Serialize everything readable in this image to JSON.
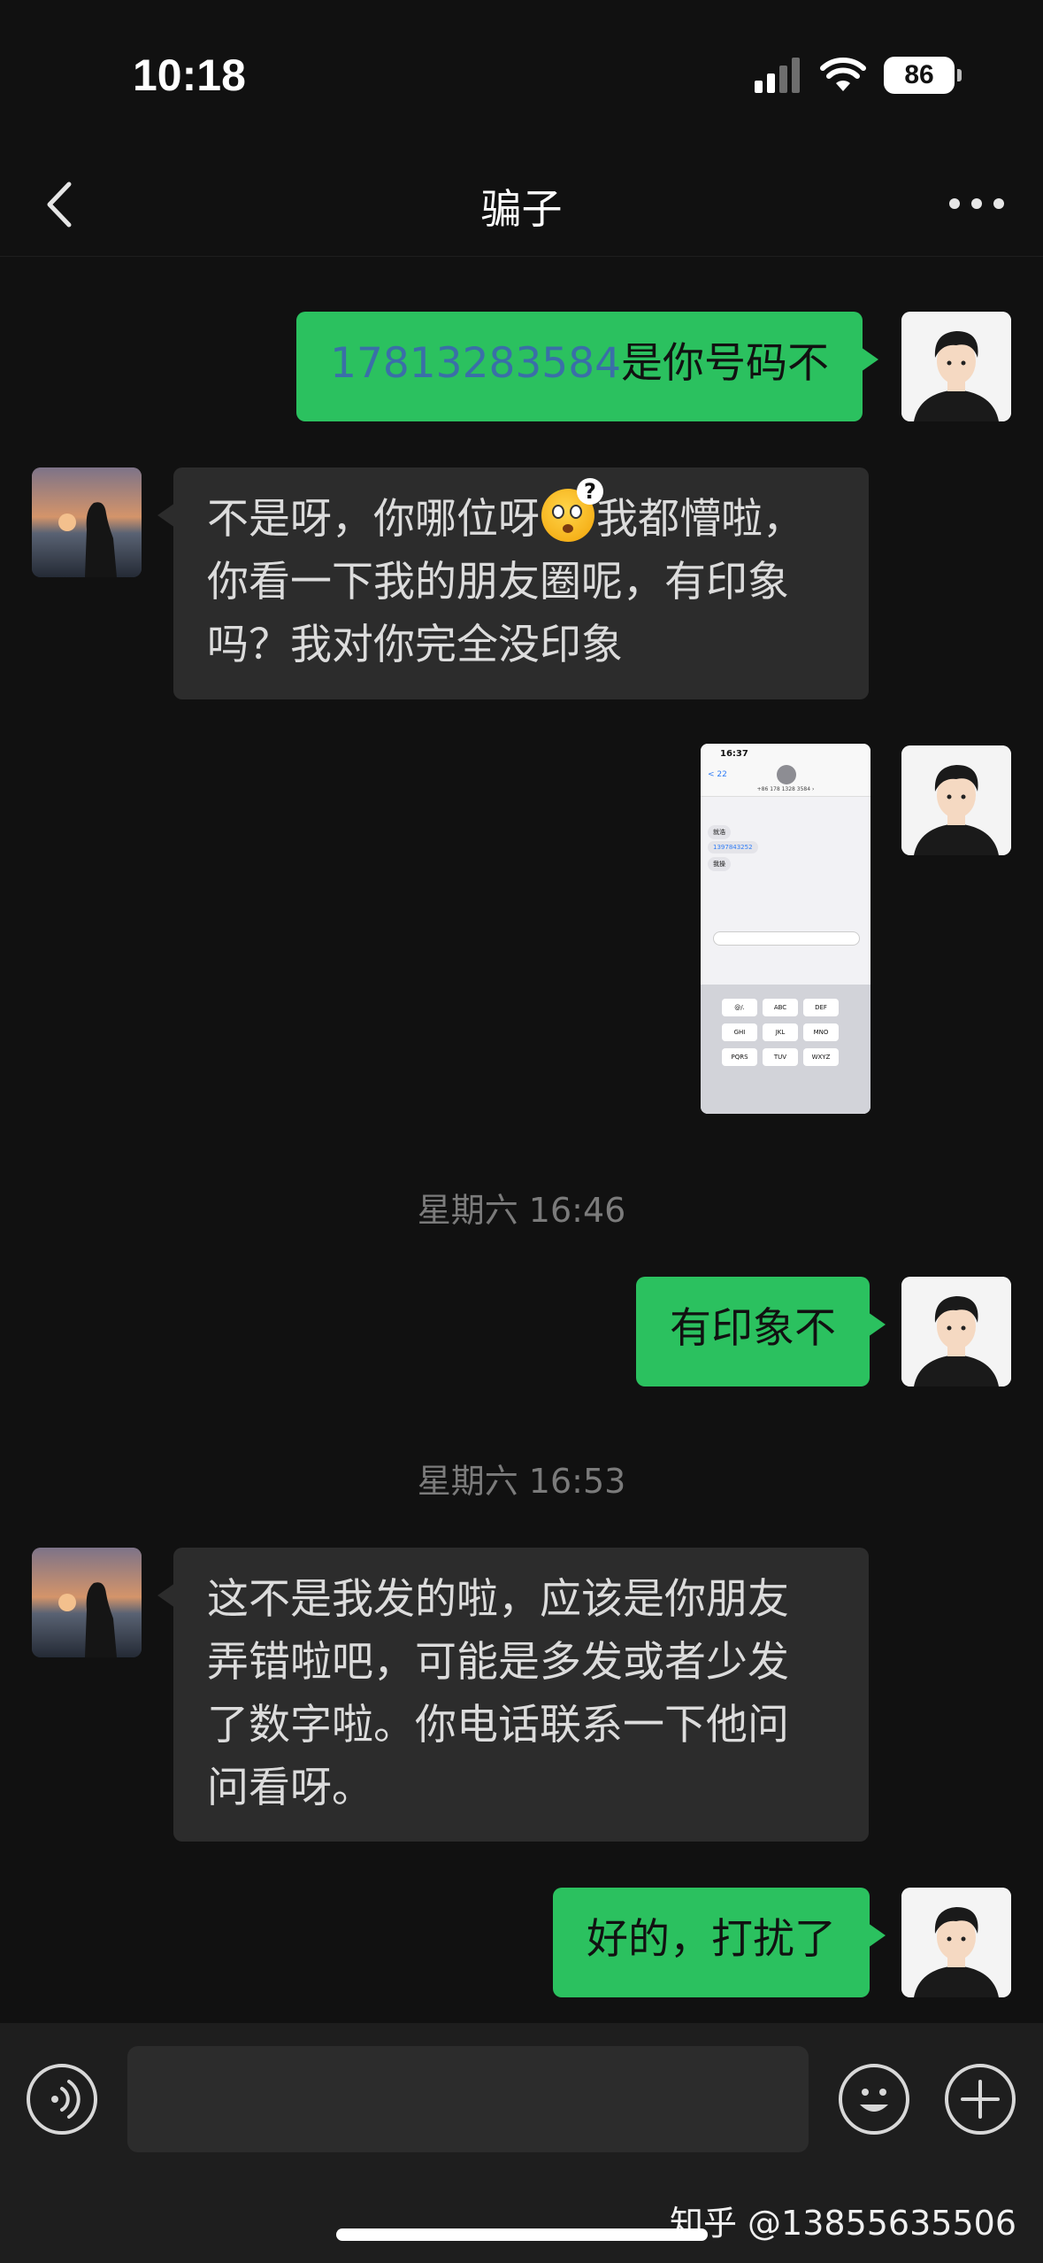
{
  "status_bar": {
    "time": "10:18",
    "battery": "86"
  },
  "header": {
    "title": "骗子",
    "back_icon": "chevron-left-icon",
    "more_icon": "more-dots-icon"
  },
  "messages": [
    {
      "from": "me",
      "phone": "17813283584",
      "text": "是你号码不"
    },
    {
      "from": "her",
      "line1_a": "不是呀，你哪位呀",
      "line1_b": "我都懵啦，",
      "line2": "你看一下我的朋友圈呢，有印象",
      "line3": "吗？我对你完全没印象",
      "emoji": "confused-face-emoji"
    },
    {
      "from": "me",
      "type": "image"
    },
    {
      "from": "me",
      "text": "有印象不"
    },
    {
      "from": "her",
      "line1": "这不是我发的啦，应该是你朋友",
      "line2": "弄错啦吧，可能是多发或者少发",
      "line3": "了数字啦。你电话联系一下他问",
      "line4": "问看呀。"
    },
    {
      "from": "me",
      "text": "好的，打扰了"
    }
  ],
  "timestamps": [
    "星期六 16:46",
    "星期六 16:53"
  ],
  "screenshot": {
    "time": "16:37",
    "back": "< 22",
    "number": "+86 178 1328 3584 ›",
    "msg_1": "就浩",
    "msg_2": "1397843252",
    "msg_3": "我操",
    "keys_row1": [
      "@/.",
      "ABC",
      "DEF"
    ],
    "keys_row2": [
      "GHI",
      "JKL",
      "MNO"
    ],
    "keys_row3": [
      "PQRS",
      "TUV",
      "WXYZ"
    ]
  },
  "input_bar": {
    "voice_icon": "voice-icon",
    "emoji_icon": "smiley-icon",
    "plus_icon": "plus-icon"
  },
  "watermark": "知乎 @13855635506",
  "colors": {
    "outgoing_bubble": "#2bc15f",
    "incoming_bubble": "#2c2c2c",
    "background": "#111111",
    "phone_link": "#3a6fa8"
  }
}
